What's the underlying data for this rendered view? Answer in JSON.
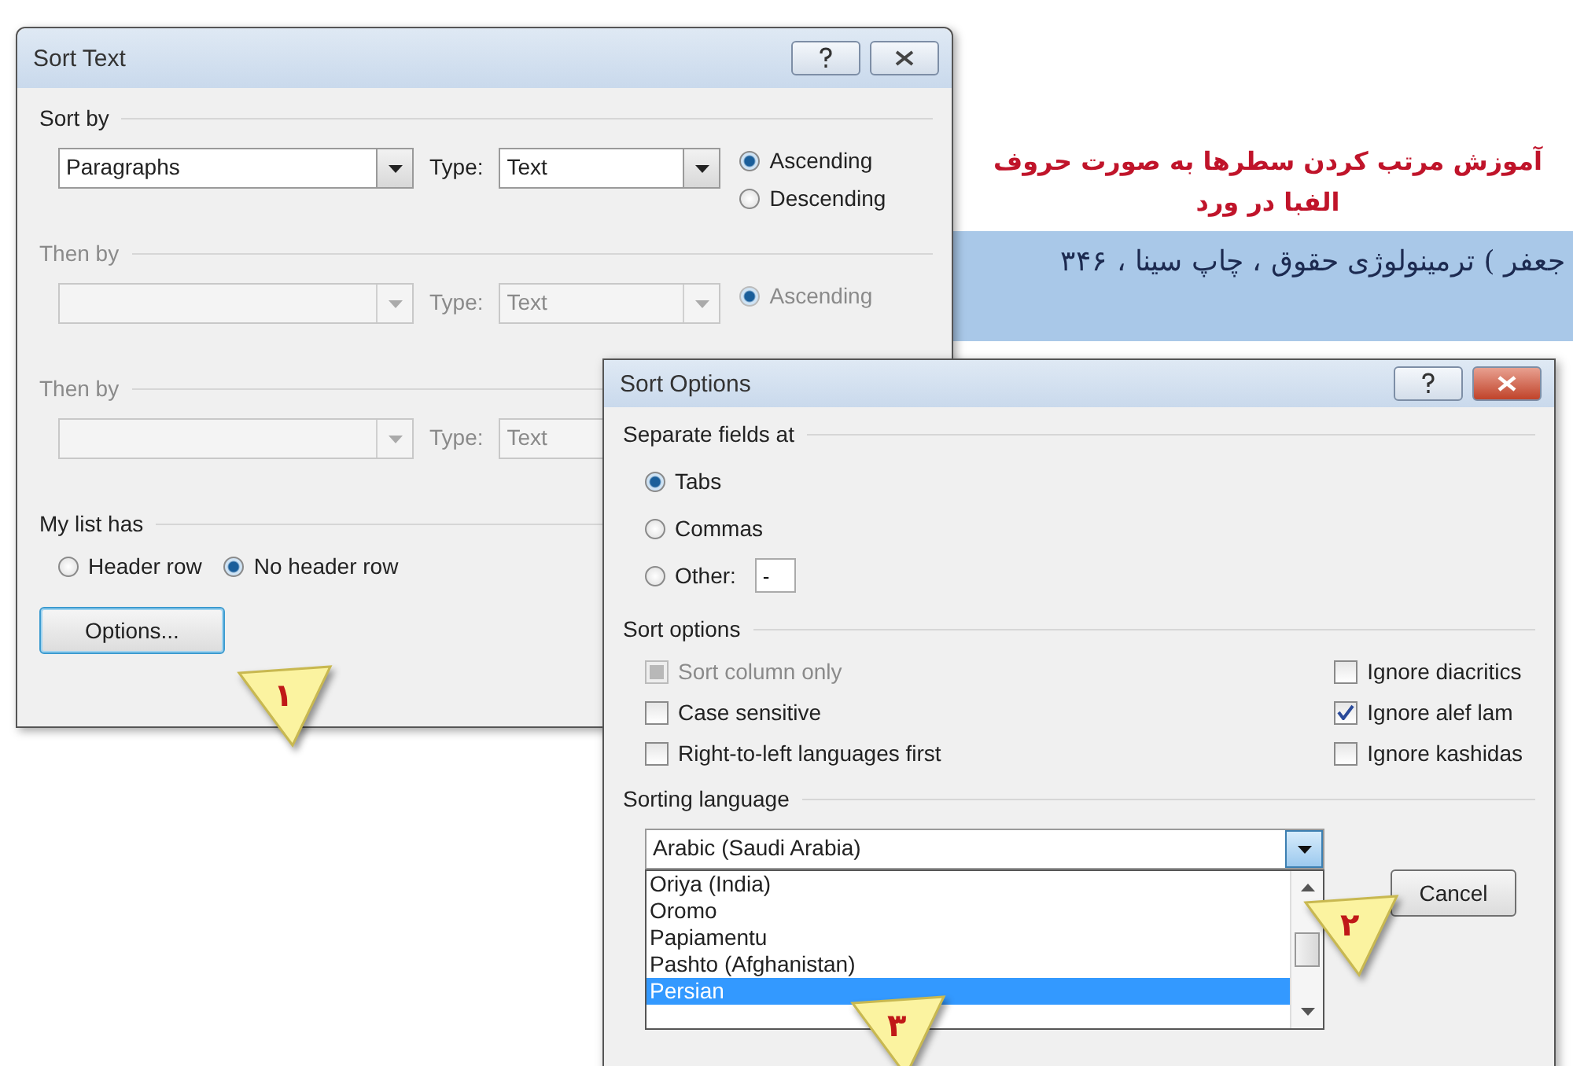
{
  "document": {
    "heading": "آموزش مرتب کردن سطرها به صورت حروف الفبا در ورد",
    "highlighted_line": "جعفر ) ترمینولوژی حقوق ، چاپ سینا ، ۳۴۶"
  },
  "sort_text_dialog": {
    "title": "Sort Text",
    "groups": [
      {
        "label": "Sort by",
        "disabled": false,
        "field": "Paragraphs",
        "type_label": "Type:",
        "type": "Text",
        "orders": [
          {
            "label": "Ascending",
            "selected": true
          },
          {
            "label": "Descending",
            "selected": false
          }
        ]
      },
      {
        "label": "Then by",
        "disabled": true,
        "type_label": "Type:",
        "type": "Text",
        "orders": [
          {
            "label": "Ascending",
            "selected": true
          }
        ]
      },
      {
        "label": "Then by",
        "disabled": true,
        "type_label": "Type:",
        "type": "Text"
      }
    ],
    "my_list_has": {
      "label": "My list has",
      "options": [
        {
          "label": "Header row",
          "selected": false
        },
        {
          "label": "No header row",
          "selected": true
        }
      ]
    },
    "options_button": "Options..."
  },
  "sort_options_dialog": {
    "title": "Sort Options",
    "separate_fields": {
      "label": "Separate fields at",
      "options": [
        {
          "label": "Tabs",
          "selected": true
        },
        {
          "label": "Commas",
          "selected": false
        },
        {
          "label": "Other:",
          "selected": false
        }
      ],
      "other_value": "-"
    },
    "sort_options": {
      "label": "Sort options",
      "left": [
        {
          "label": "Sort column only",
          "checked": false,
          "disabled": true
        },
        {
          "label": "Case sensitive",
          "checked": false,
          "disabled": false
        },
        {
          "label": "Right-to-left languages first",
          "checked": false,
          "disabled": false
        }
      ],
      "right": [
        {
          "label": "Ignore diacritics",
          "checked": false,
          "disabled": false
        },
        {
          "label": "Ignore alef lam",
          "checked": true,
          "disabled": false
        },
        {
          "label": "Ignore kashidas",
          "checked": false,
          "disabled": false
        }
      ]
    },
    "sorting_language": {
      "label": "Sorting language",
      "value": "Arabic (Saudi Arabia)",
      "list": [
        {
          "label": "Oriya (India)",
          "selected": false
        },
        {
          "label": "Oromo",
          "selected": false
        },
        {
          "label": "Papiamentu",
          "selected": false
        },
        {
          "label": "Pashto (Afghanistan)",
          "selected": false
        },
        {
          "label": "Persian",
          "selected": true
        }
      ]
    },
    "cancel_button": "Cancel"
  },
  "callouts": [
    {
      "label": "١"
    },
    {
      "label": "٢"
    },
    {
      "label": "٣"
    }
  ]
}
